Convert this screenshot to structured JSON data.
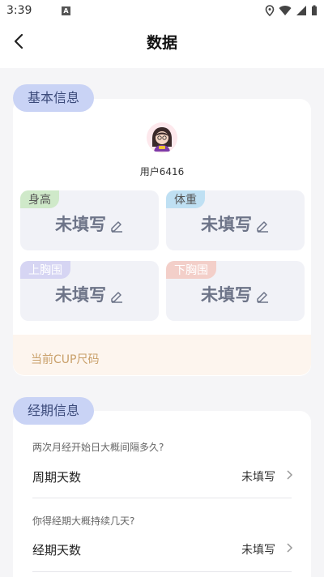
{
  "status_bar": {
    "time": "3:39",
    "a_badge": "A"
  },
  "header": {
    "title": "数据"
  },
  "basic": {
    "tab_label": "基本信息",
    "username": "用户6416",
    "metrics": [
      {
        "label": "身高",
        "value": "未填写",
        "tag_color": "#cfe9c9"
      },
      {
        "label": "体重",
        "value": "未填写",
        "tag_color": "#bfe0f3"
      },
      {
        "label": "上胸围",
        "value": "未填写",
        "tag_color": "#d6d5f3"
      },
      {
        "label": "下胸围",
        "value": "未填写",
        "tag_color": "#f3cfc9"
      }
    ],
    "cup_label": "当前CUP尺码"
  },
  "period": {
    "tab_label": "经期信息",
    "q1": "两次月经开始日大概间隔多久?",
    "cycle_label": "周期天数",
    "cycle_value": "未填写",
    "q2": "你得经期大概持续几天?",
    "duration_label": "经期天数",
    "duration_value": "未填写"
  },
  "colors": {
    "accent_tab": "#c9d3f5",
    "value_text": "#6d7488",
    "cup_text": "#c9a06a"
  }
}
